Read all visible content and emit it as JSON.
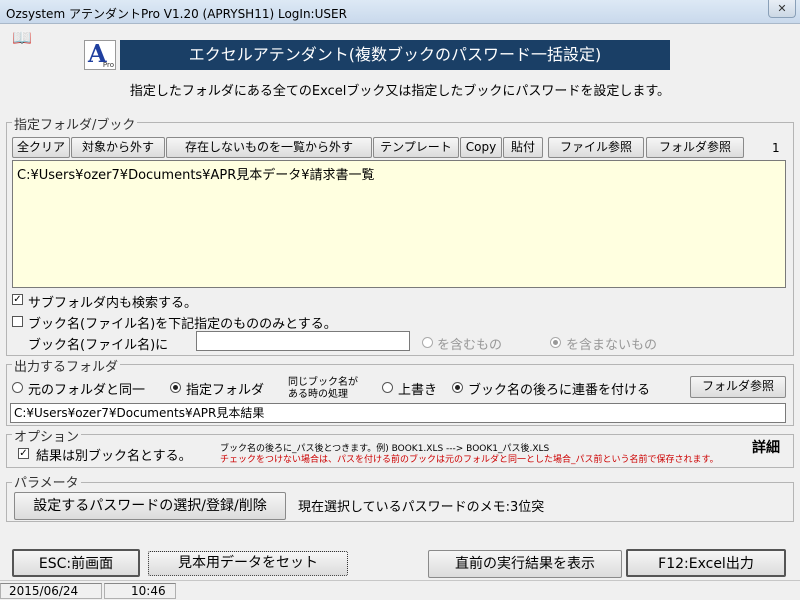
{
  "window": {
    "title": "Ozsystem アテンダントPro V1.20 (APRYSH11)  LogIn:USER",
    "close": "✕"
  },
  "header": {
    "logo_letter": "A",
    "logo_pro": "Pro",
    "banner": "エクセルアテンダント(複数ブックのパスワード一括設定)",
    "subtitle": "指定したフォルダにある全てのExcelブック又は指定したブックにパスワードを設定します。"
  },
  "folder_group": {
    "legend": "指定フォルダ/ブック",
    "toolbar": [
      "全クリア",
      "対象から外す",
      "存在しないものを一覧から外す",
      "テンプレート",
      "Copy",
      "貼付",
      "ファイル参照",
      "フォルダ参照"
    ],
    "count": "1",
    "list_text": "C:¥Users¥ozer7¥Documents¥APR見本データ¥請求書一覧",
    "subfolder_label": "サブフォルダ内も検索する。",
    "subfolder_checked": true,
    "bookname_filter_label": "ブック名(ファイル名)を下記指定のもののみとする。",
    "bookname_filter_checked": false,
    "bookname_label": "ブック名(ファイル名)に",
    "bookname_value": "",
    "include_label": "を含むもの",
    "exclude_label": "を含まないもの"
  },
  "output_group": {
    "legend": "出力するフォルダ",
    "same_folder_label": "元のフォルダと同一",
    "specified_folder_label": "指定フォルダ",
    "same_name_label_1": "同じブック名が",
    "same_name_label_2": "ある時の処理",
    "overwrite_label": "上書き",
    "serial_label": "ブック名の後ろに連番を付ける",
    "folder_browse": "フォルダ参照",
    "path": "C:¥Users¥ozer7¥Documents¥APR見本結果"
  },
  "options_group": {
    "legend": "オプション",
    "separate_name_label": "結果は別ブック名とする。",
    "separate_name_checked": true,
    "note_line1": "ブック名の後ろに_パス後とつきます。例) BOOK1.XLS ---> BOOK1_パス後.XLS",
    "note_line2": "チェックをつけない場合は、パスを付ける前のブックは元のフォルダと同一とした場合_パス前という名前で保存されます。",
    "details": "詳細"
  },
  "params_group": {
    "legend": "パラメータ",
    "password_button": "設定するパスワードの選択/登録/削除",
    "memo": "現在選択しているパスワードのメモ:3位突"
  },
  "footer": {
    "esc": "ESC:前画面",
    "sample": "見本用データをセット",
    "last_result": "直前の実行結果を表示",
    "excel": "F12:Excel出力"
  },
  "status": {
    "date": "2015/06/24",
    "time": "10:46"
  }
}
